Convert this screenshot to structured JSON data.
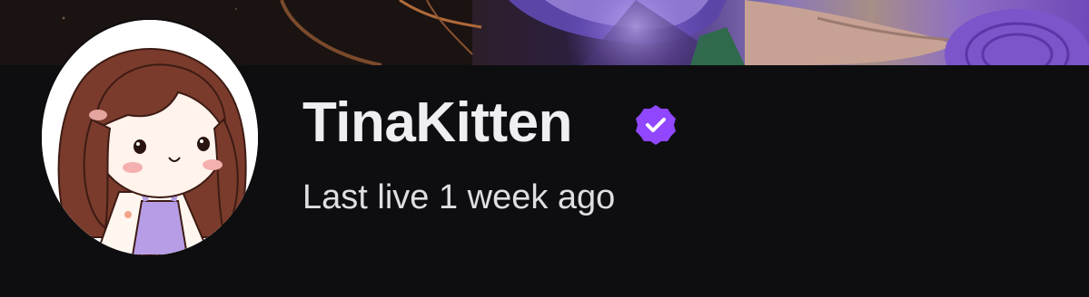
{
  "channel": {
    "name": "TinaKitten",
    "verified": true,
    "status": "Last live 1 week ago"
  },
  "icons": {
    "verified": "verified-badge-icon",
    "avatar": "cartoon-girl-avatar"
  },
  "colors": {
    "background": "#0e0e10",
    "text_primary": "#efeff1",
    "text_secondary": "#dedee3",
    "verified_purple": "#9147ff"
  }
}
